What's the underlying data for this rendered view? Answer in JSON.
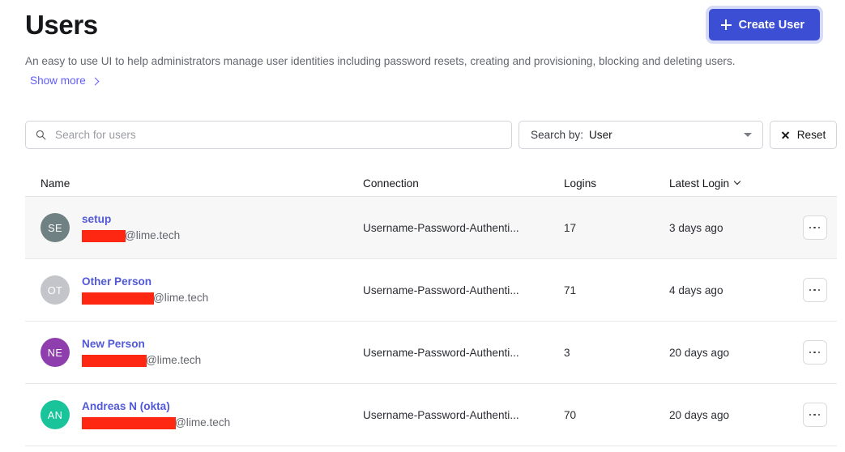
{
  "header": {
    "title": "Users",
    "create_button_label": "Create User",
    "create_button_icon": "plus-icon",
    "accent_color": "#3c4fd4",
    "link_color": "#635dff"
  },
  "description": {
    "text": "An easy to use UI to help administrators manage user identities including password resets, creating and provisioning, blocking and deleting users.",
    "show_more_label": "Show more",
    "show_more_icon": "chevron-right-icon"
  },
  "filters": {
    "search": {
      "placeholder": "Search for users",
      "value": "",
      "icon": "search-icon"
    },
    "search_by": {
      "label": "Search by:",
      "value": "User",
      "icon": "chevron-down-icon",
      "options": [
        "User"
      ]
    },
    "reset": {
      "label": "Reset",
      "icon": "close-icon"
    }
  },
  "table": {
    "columns": [
      {
        "key": "name",
        "label": "Name"
      },
      {
        "key": "connection",
        "label": "Connection"
      },
      {
        "key": "logins",
        "label": "Logins"
      },
      {
        "key": "latest_login",
        "label": "Latest Login",
        "sort_icon": "chevron-down-icon"
      }
    ],
    "row_action_icon": "ellipsis-icon",
    "rows": [
      {
        "initials": "SE",
        "avatar_color": "#6f8183",
        "name": "setup",
        "email_redacted_width": 54,
        "email_domain": "@lime.tech",
        "connection": "Username-Password-Authenti...",
        "logins": "17",
        "latest_login": "3 days ago",
        "highlighted": true
      },
      {
        "initials": "OT",
        "avatar_color": "#c3c5ca",
        "name": "Other Person",
        "email_redacted_width": 89,
        "email_domain": "@lime.tech",
        "connection": "Username-Password-Authenti...",
        "logins": "71",
        "latest_login": "4 days ago",
        "highlighted": false
      },
      {
        "initials": "NE",
        "avatar_color": "#8e3fad",
        "name": "New Person",
        "email_redacted_width": 80,
        "email_domain": "@lime.tech",
        "connection": "Username-Password-Authenti...",
        "logins": "3",
        "latest_login": "20 days ago",
        "highlighted": false
      },
      {
        "initials": "AN",
        "avatar_color": "#19c49a",
        "name": "Andreas N (okta)",
        "email_redacted_width": 116,
        "email_domain": "@lime.tech",
        "connection": "Username-Password-Authenti...",
        "logins": "70",
        "latest_login": "20 days ago",
        "highlighted": false
      }
    ]
  }
}
